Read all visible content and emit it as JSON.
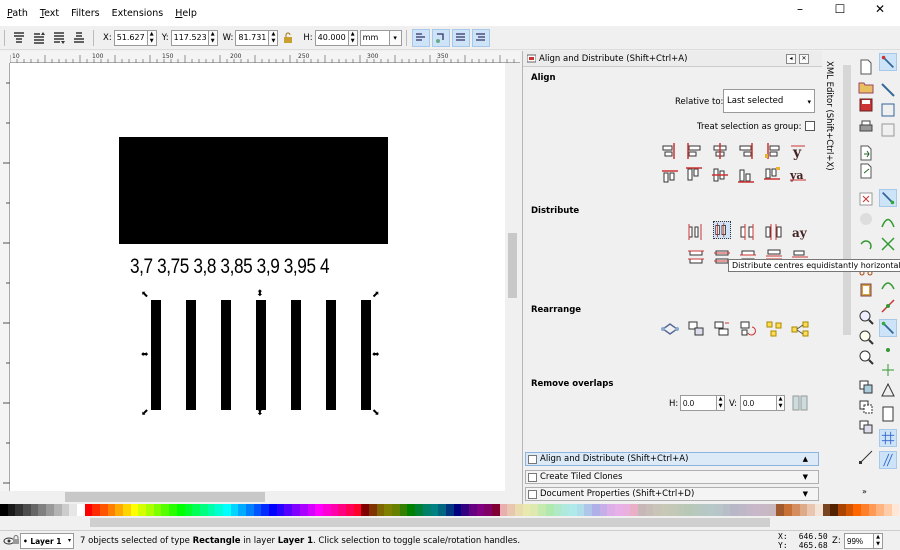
{
  "menu": [
    {
      "label": "Path",
      "accel": "P",
      "rest": "ath"
    },
    {
      "label": "Text",
      "accel": "T",
      "rest": "ext"
    },
    {
      "label": "Filters",
      "accel": "",
      "rest": "Filters"
    },
    {
      "label": "Extensions",
      "accel": "",
      "rest": "Extensions"
    },
    {
      "label": "Help",
      "accel": "H",
      "rest": "elp"
    }
  ],
  "window_controls": [
    "–",
    "☐",
    "✕"
  ],
  "toolbar": {
    "x_label": "X:",
    "x_value": "51.627",
    "y_label": "Y:",
    "y_value": "117.523",
    "w_label": "W:",
    "w_value": "81.731",
    "h_label": "H:",
    "h_value": "40.000",
    "unit": "mm"
  },
  "ruler_ticks": [
    "10",
    "100",
    "150",
    "200",
    "250",
    "300",
    "350"
  ],
  "canvas": {
    "number_labels": "3,7 3,75 3,8 3,85 3,9 3,95 4"
  },
  "dock": {
    "header_title": "Align and Distribute (Shift+Ctrl+A)",
    "align_title": "Align",
    "relative_to_label": "Relative to:",
    "relative_to_value": "Last selected",
    "treat_group_label": "Treat selection as group:",
    "distribute_title": "Distribute",
    "rearrange_title": "Rearrange",
    "remove_overlaps_title": "Remove overlaps",
    "h_label": "H:",
    "h_value": "0.0",
    "v_label": "V:",
    "v_value": "0.0",
    "tooltip": "Distribute centres equidistantly horizontally",
    "tabs": [
      "Align and Distribute (Shift+Ctrl+A)",
      "Create Tiled Clones",
      "Document Properties (Shift+Ctrl+D)"
    ],
    "side_tab": "XML Editor (Shift+Ctrl+X)"
  },
  "status": {
    "layer": "Layer 1",
    "message_prefix": "7 objects selected of type ",
    "message_type": "Rectangle",
    "message_middle": " in layer ",
    "message_layer": "Layer 1",
    "message_suffix": ". Click selection to toggle scale/rotation handles.",
    "x_label": "X:",
    "x_value": "646.50",
    "y_label": "Y:",
    "y_value": "465.68",
    "zoom_label": "Z:",
    "zoom_value": "99%"
  },
  "palette_colors": [
    "#000000",
    "#1a1a1a",
    "#333333",
    "#4d4d4d",
    "#666666",
    "#808080",
    "#999999",
    "#b3b3b3",
    "#cccccc",
    "#e6e6e6",
    "#ffffff",
    "#ff0000",
    "#ff2a00",
    "#ff5500",
    "#ff8000",
    "#ffaa00",
    "#ffd400",
    "#ffff00",
    "#d4ff00",
    "#aaff00",
    "#80ff00",
    "#55ff00",
    "#2aff00",
    "#00ff00",
    "#00ff2a",
    "#00ff55",
    "#00ff80",
    "#00ffaa",
    "#00ffd4",
    "#00ffff",
    "#00d4ff",
    "#00aaff",
    "#0080ff",
    "#0055ff",
    "#002aff",
    "#0000ff",
    "#2a00ff",
    "#5500ff",
    "#8000ff",
    "#aa00ff",
    "#d400ff",
    "#ff00ff",
    "#ff00d4",
    "#ff00aa",
    "#ff0080",
    "#ff0055",
    "#ff002a",
    "#800000",
    "#803300",
    "#806600",
    "#808000",
    "#668000",
    "#338000",
    "#008000",
    "#008033",
    "#008066",
    "#008080",
    "#006680",
    "#003380",
    "#000080",
    "#330080",
    "#660080",
    "#800080",
    "#800066",
    "#800033",
    "#e9afaf",
    "#e9c6af",
    "#e9ddaf",
    "#e9e9af",
    "#dde9af",
    "#c6e9af",
    "#afe9af",
    "#afe9c6",
    "#afe9dd",
    "#afe9e9",
    "#afdde9",
    "#afc6e9",
    "#afafe9",
    "#c6afe9",
    "#ddafe9",
    "#e9afe9",
    "#e9afdd",
    "#e9afc6",
    "#c8b7b7",
    "#c8beb7",
    "#c8c4b7",
    "#c8c8b7",
    "#c4c8b7",
    "#bec8b7",
    "#b7c8b7",
    "#b7c8be",
    "#b7c8c4",
    "#b7c8c8",
    "#b7c4c8",
    "#b7bec8",
    "#b7b7c8",
    "#beb7c8",
    "#c4b7c8",
    "#c8b7c8",
    "#c8b7c4",
    "#c8b7be",
    "#a05a2c",
    "#c87137",
    "#d38d5f",
    "#deaa87",
    "#e9c6af",
    "#f4e3d7",
    "#784421",
    "#552200",
    "#aa4400",
    "#d45500",
    "#ff6600",
    "#ff7f2a",
    "#ff9955",
    "#ffb380",
    "#ffccaa",
    "#ffe6d5"
  ]
}
